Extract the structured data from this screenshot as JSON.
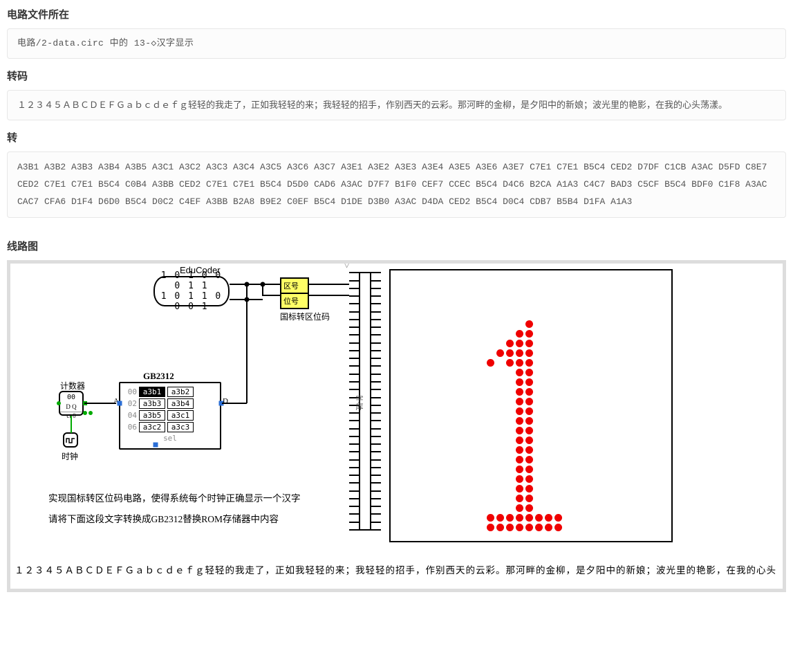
{
  "sections": {
    "file_title": "电路文件所在",
    "file_path": "电路/2-data.circ 中的 13-◇汉字显示",
    "transcode_title": "转码",
    "transcode_body": "１２３４５ＡＢＣＤＥＦＧａｂｃｄｅｆｇ轻轻的我走了，正如我轻轻的来；我轻轻的招手，作别西天的云彩。那河畔的金柳，是夕阳中的新娘；波光里的艳影，在我的心头荡漾。",
    "trans_title": "转",
    "hex_codes": "A3B1 A3B2 A3B3 A3B4 A3B5 A3C1 A3C2 A3C3 A3C4 A3C5 A3C6 A3C7 A3E1 A3E2 A3E3 A3E4 A3E5 A3E6 A3E7 C7E1 C7E1 B5C4 CED2 D7DF C1CB A3AC D5FD C8E7 CED2 C7E1 C7E1 B5C4 C0B4 A3BB CED2 C7E1 C7E1 B5C4 D5D0 CAD6 A3AC D7F7 B1F0 CEF7 CCEC B5C4 D4C6 B2CA A1A3 C4C7 BAD3 C5CF B5C4 BDF0 C1F8 A3AC CAC7 CFA6 D1F4 D6D0 B5C4 D0C2 C4EF A3BB B2A8 B9E2 C0EF B5C4 D1DE D3B0 A3AC D4DA CED2 B5C4 D0C4 CDB7 B5B4 D1FA A1A3",
    "circuit_title": "线路图"
  },
  "diagram": {
    "educoder_title": "EduCoder",
    "educoder_bits1": "1 0 1 0 0 0 1 1",
    "educoder_bits2": "1 0 1 1 0 0 0 1",
    "qw_label1": "区号",
    "qw_label2": "位号",
    "qw_caption": "国标转区位码",
    "counter_label": "计数器",
    "counter_text1": "00",
    "counter_text2": "ct 0",
    "counter_io": "D Q",
    "clock_label": "时钟",
    "rom_title": "GB2312",
    "rom_rows": [
      {
        "addr": "00",
        "a": "a3b1",
        "b": "a3b2",
        "sel": true
      },
      {
        "addr": "02",
        "a": "a3b3",
        "b": "a3b4",
        "sel": false
      },
      {
        "addr": "04",
        "a": "a3b5",
        "b": "a3c1",
        "sel": false
      },
      {
        "addr": "06",
        "a": "a3c2",
        "b": "a3c3",
        "sel": false
      }
    ],
    "rom_sel": "sel",
    "pin_A": "A",
    "pin_D": "D",
    "bus_label": "字库",
    "caption1": "实现国标转区位码电路，使得系统每个时钟正确显示一个汉字",
    "caption2": "请将下面这段文字转换成GB2312替换ROM存储器中内容",
    "footer": "１２３４５ＡＢＣＤＥＦＧａｂｃｄｅｆｇ轻轻的我走了，正如我轻轻的来；我轻轻的招手，作别西天的云彩。那河畔的金柳，是夕阳中的新娘；波光里的艳影，在我的心头"
  }
}
